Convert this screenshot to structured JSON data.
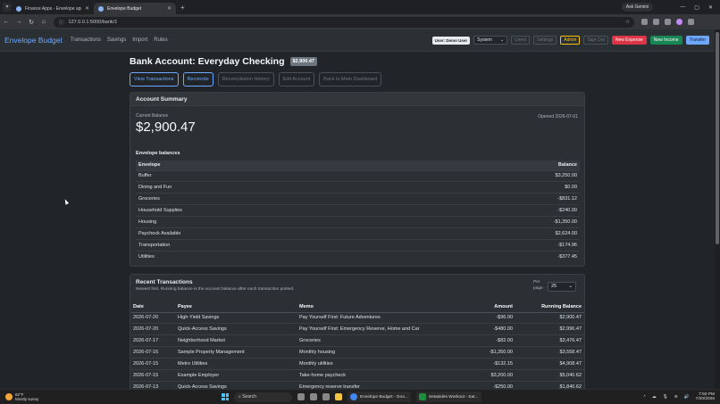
{
  "browser": {
    "tabs": [
      {
        "title": "Finance Apps - Envelope app a...",
        "active": false
      },
      {
        "title": "Envelope Budget",
        "active": true
      }
    ],
    "ask_gemini": "Ask Gemini",
    "url": "127.0.0.1:5000/bank/1"
  },
  "nav": {
    "brand": "Envelope Budget",
    "links": [
      "Transactions",
      "Savings",
      "Import",
      "Rules"
    ],
    "user_badge": "User: Demo User",
    "theme_select": "System",
    "buttons": {
      "users": "Users",
      "settings": "Settings",
      "admin": "Admin",
      "signout": "Sign Out",
      "new_expense": "New Expense",
      "new_income": "New Income",
      "transfer": "Transfer"
    }
  },
  "page": {
    "title": "Bank Account: Everyday Checking",
    "balance_badge": "$2,900.47",
    "actions": [
      "View Transactions",
      "Reconcile",
      "Reconciliation History",
      "Edit Account",
      "Back to Main Dashboard"
    ]
  },
  "summary": {
    "heading": "Account Summary",
    "current_balance_label": "Current Balance",
    "current_balance": "$2,900.47",
    "opened": "Opened 2026-07-01",
    "envelope_title": "Envelope balances",
    "columns": [
      "Envelope",
      "Balance"
    ],
    "envelopes": [
      {
        "name": "Buffer",
        "balance": "$3,250.00",
        "negative": false
      },
      {
        "name": "Dining and Fun",
        "balance": "$0.00",
        "negative": false
      },
      {
        "name": "Groceries",
        "balance": "-$831.12",
        "negative": true
      },
      {
        "name": "Household Supplies",
        "balance": "-$240.00",
        "negative": true
      },
      {
        "name": "Housing",
        "balance": "-$1,350.00",
        "negative": true
      },
      {
        "name": "Paycheck Available",
        "balance": "$2,624.00",
        "negative": false
      },
      {
        "name": "Transportation",
        "balance": "-$174.96",
        "negative": true
      },
      {
        "name": "Utilities",
        "balance": "-$377.45",
        "negative": true
      }
    ]
  },
  "transactions": {
    "heading": "Recent Transactions",
    "subtitle": "Newest first. Running balance is the account balance after each transaction posted.",
    "per_page_label": "Per page",
    "per_page": "25",
    "columns": [
      "Date",
      "Payee",
      "Memo",
      "Amount",
      "Running Balance"
    ],
    "rows": [
      {
        "date": "2026-07-20",
        "payee": "High-Yield Savings",
        "memo": "Pay Yourself First: Future Adventures",
        "amount": "-$96.00",
        "balance": "$2,900.47",
        "negative": true
      },
      {
        "date": "2026-07-20",
        "payee": "Quick-Access Savings",
        "memo": "Pay Yourself First: Emergency Reserve, Home and Car",
        "amount": "-$480.00",
        "balance": "$2,996.47",
        "negative": true
      },
      {
        "date": "2026-07-17",
        "payee": "Neighborhood Market",
        "memo": "Groceries",
        "amount": "-$82.00",
        "balance": "$3,476.47",
        "negative": true
      },
      {
        "date": "2026-07-16",
        "payee": "Sample Property Management",
        "memo": "Monthly housing",
        "amount": "-$1,350.00",
        "balance": "$3,558.47",
        "negative": true
      },
      {
        "date": "2026-07-15",
        "payee": "Metro Utilities",
        "memo": "Monthly utilities",
        "amount": "-$132.15",
        "balance": "$4,908.47",
        "negative": true
      },
      {
        "date": "2026-07-15",
        "payee": "Example Employer",
        "memo": "Take-home paycheck",
        "amount": "$3,200.00",
        "balance": "$5,040.62",
        "negative": false
      },
      {
        "date": "2026-07-13",
        "payee": "Quick-Access Savings",
        "memo": "Emergency reserve transfer",
        "amount": "-$250.00",
        "balance": "$1,840.62",
        "negative": true
      }
    ]
  },
  "taskbar": {
    "weather_temp": "82°F",
    "weather_desc": "Mostly sunny",
    "search": "Search",
    "apps": [
      "Envelope Budget - Goo...",
      "Setasides Workout - Sar..."
    ],
    "time": "7:50 PM",
    "date": "7/20/2026"
  }
}
